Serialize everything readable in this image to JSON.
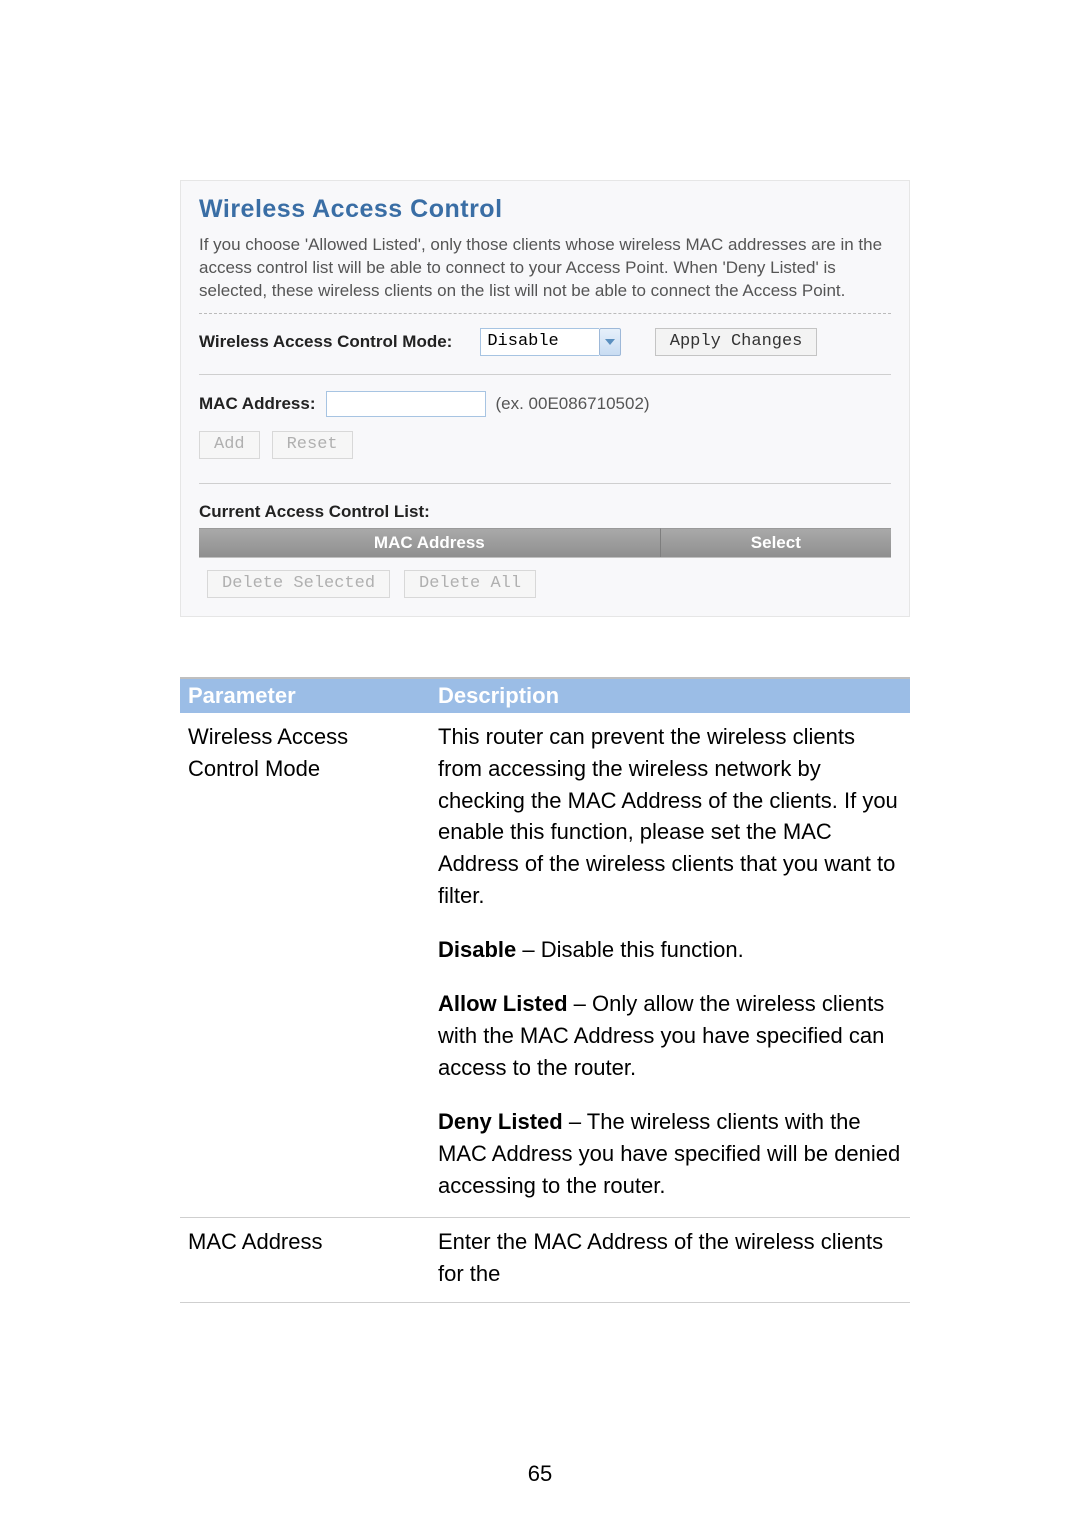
{
  "panel": {
    "title": "Wireless Access Control",
    "description": "If you choose 'Allowed Listed', only those clients whose wireless MAC addresses are in the access control list will be able to connect to your Access Point. When 'Deny Listed' is selected, these wireless clients on the list will not be able to connect the Access Point.",
    "mode_label": "Wireless Access Control Mode:",
    "mode_value": "Disable",
    "apply_btn": "Apply Changes",
    "mac_label": "MAC Address:",
    "mac_hint": "(ex. 00E086710502)",
    "add_btn": "Add",
    "reset_btn": "Reset",
    "list_title": "Current Access Control List:",
    "th_mac": "MAC Address",
    "th_select": "Select",
    "delete_selected_btn": "Delete Selected",
    "delete_all_btn": "Delete All"
  },
  "params": {
    "header_param": "Parameter",
    "header_desc": "Description",
    "rows": [
      {
        "name": "Wireless Access Control Mode",
        "desc_intro": "This router can prevent the wireless clients from accessing the wireless network by checking the MAC Address of the clients. If you enable this function, please set the MAC Address of the wireless clients that you want to filter.",
        "disable_label": "Disable",
        "disable_text": " – Disable this function.",
        "allow_label": "Allow Listed",
        "allow_text": " – Only allow the wireless clients with the MAC Address you have specified can access to the router.",
        "deny_label": "Deny Listed",
        "deny_text": " – The wireless clients with the MAC Address you have specified will be denied accessing to the router."
      },
      {
        "name": "MAC Address",
        "desc_intro": "Enter the MAC Address of the wireless clients for the"
      }
    ]
  },
  "page_number": "65"
}
